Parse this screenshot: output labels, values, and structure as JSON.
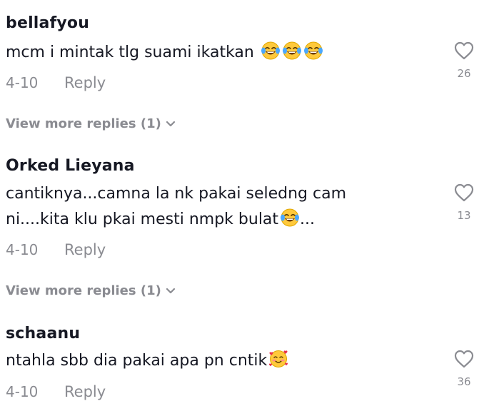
{
  "comments": [
    {
      "author": "bellafyou",
      "text": "mcm i mintak tlg suami ikatkan",
      "emojis": [
        "face-with-tears-of-joy",
        "face-with-tears-of-joy",
        "face-with-tears-of-joy"
      ],
      "date": "4-10",
      "reply_label": "Reply",
      "like_count": "26",
      "view_more": "View more replies (1)"
    },
    {
      "author": "Orked Lieyana",
      "text_line1": "cantiknya...camna la nk pakai seledng cam",
      "text_line2_before": "ni....kita klu pkai mesti nmpk bulat",
      "emojis": [
        "face-with-tears-of-joy"
      ],
      "text_line2_after": "...",
      "date": "4-10",
      "reply_label": "Reply",
      "like_count": "13",
      "view_more": "View more replies (1)"
    },
    {
      "author": "schaanu",
      "text": "ntahla sbb dia pakai apa pn cntik",
      "emojis": [
        "smiling-face-with-hearts"
      ],
      "date": "4-10",
      "reply_label": "Reply",
      "like_count": "36"
    }
  ],
  "colors": {
    "text": "#161823",
    "muted": "#8a8b91",
    "emoji_yellow": "#ffc93c",
    "emoji_tear": "#4aa8ff",
    "heart": "#e8334a"
  },
  "icons": {
    "like": "heart-outline-icon",
    "expand": "chevron-down-icon"
  }
}
